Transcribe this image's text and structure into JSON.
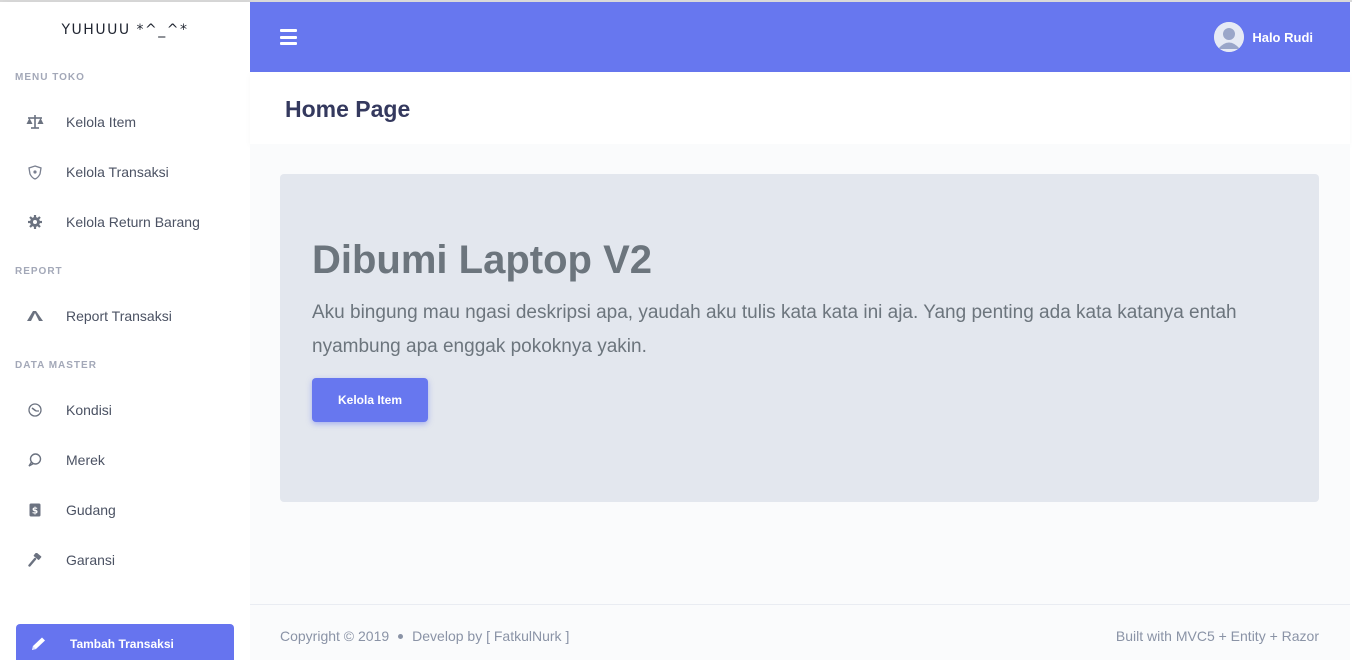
{
  "sidebar": {
    "brand": "YUHUUU *^_^*",
    "sections": {
      "menu_toko": "MENU TOKO",
      "report": "REPORT",
      "data_master": "DATA MASTER"
    },
    "items": {
      "kelola_item": "Kelola Item",
      "kelola_transaksi": "Kelola Transaksi",
      "kelola_return": "Kelola Return Barang",
      "report_transaksi": "Report Transaksi",
      "kondisi": "Kondisi",
      "merek": "Merek",
      "gudang": "Gudang",
      "garansi": "Garansi"
    },
    "add_button": "Tambah Transaksi"
  },
  "header": {
    "user_name": "Halo Rudi",
    "accent": "#6777ef"
  },
  "page": {
    "title": "Home Page"
  },
  "jumbotron": {
    "title": "Dibumi Laptop V2",
    "text": "Aku bingung mau ngasi deskripsi apa, yaudah aku tulis kata kata ini aja. Yang penting ada kata katanya entah nyambung apa enggak pokoknya yakin.",
    "button": "Kelola Item"
  },
  "footer": {
    "copyright": "Copyright © 2019",
    "develop": "Develop by [ FatkulNurk ]",
    "built": "Built with MVC5 + Entity + Razor"
  }
}
